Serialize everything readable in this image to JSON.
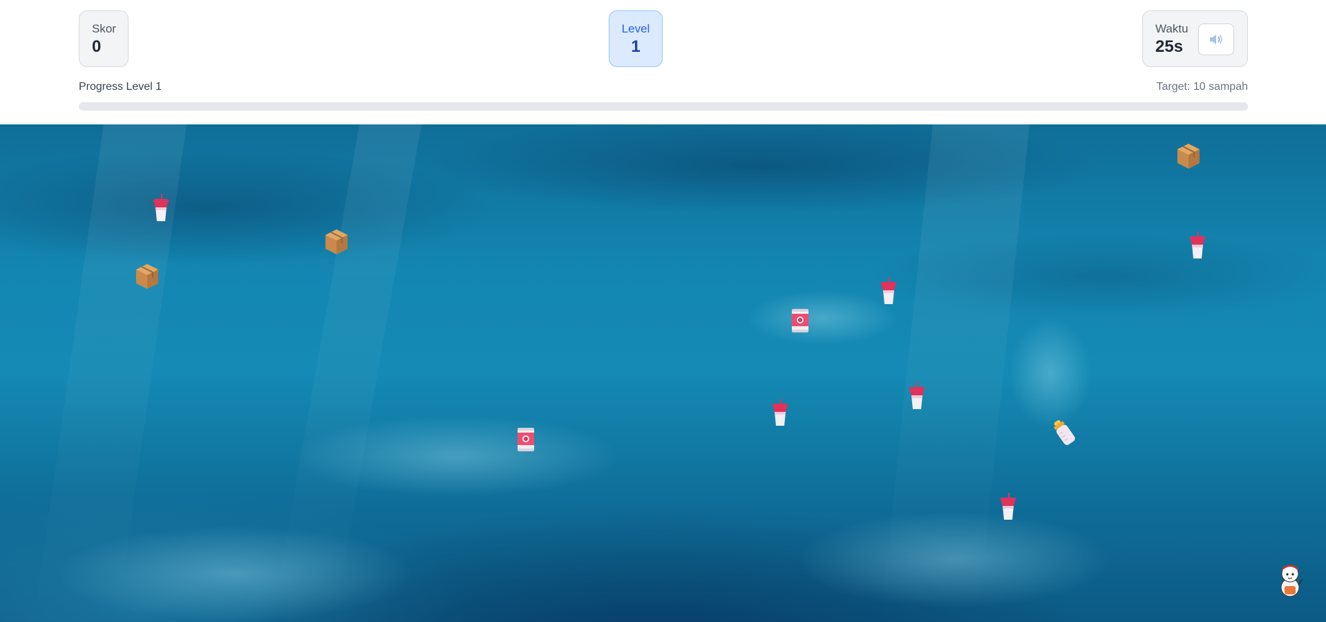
{
  "hud": {
    "score_label": "Skor",
    "score_value": "0",
    "level_label": "Level",
    "level_value": "1",
    "time_label": "Waktu",
    "time_value": "25s",
    "sound_icon": "speaker-icon",
    "progress_label": "Progress Level 1",
    "target_label": "Target: 10 sampah",
    "progress_fraction": 0
  },
  "trash_items": [
    {
      "type": "box",
      "icon": "cardboard-box-icon"
    },
    {
      "type": "cup",
      "icon": "drink-cup-icon"
    },
    {
      "type": "box",
      "icon": "cardboard-box-icon"
    },
    {
      "type": "box",
      "icon": "cardboard-box-icon"
    },
    {
      "type": "cup",
      "icon": "drink-cup-icon"
    },
    {
      "type": "cup",
      "icon": "drink-cup-icon"
    },
    {
      "type": "can",
      "icon": "tin-can-icon"
    },
    {
      "type": "cup",
      "icon": "drink-cup-icon"
    },
    {
      "type": "cup",
      "icon": "drink-cup-icon"
    },
    {
      "type": "bottle",
      "icon": "baby-bottle-icon"
    },
    {
      "type": "can",
      "icon": "tin-can-icon"
    },
    {
      "type": "cup",
      "icon": "drink-cup-icon"
    }
  ],
  "player": {
    "icon": "diver-mascot-icon"
  },
  "colors": {
    "level_card_bg": "#dbeafe",
    "level_text": "#1e40af",
    "ocean": "#1387b2"
  }
}
